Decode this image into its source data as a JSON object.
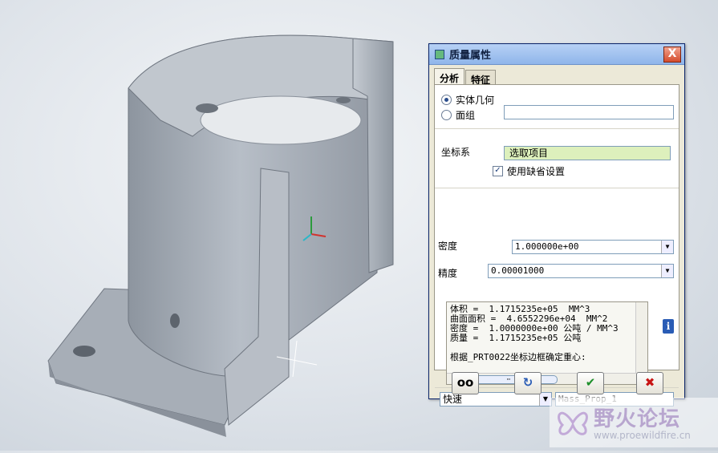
{
  "dialog": {
    "title": "质量属性",
    "close": "X",
    "tabs": [
      "分析",
      "特征"
    ],
    "geometry": {
      "solid": "实体几何",
      "quilt": "面组"
    },
    "csys_label": "坐标系",
    "csys_value": "选取项目",
    "use_default": "使用缺省设置",
    "density_label": "密度",
    "density_value": "1.000000e+00",
    "accuracy_label": "精度",
    "accuracy_value": "0.00001000",
    "results": [
      "体积 =  1.1715235e+05  MM^3",
      "曲面面积 =  4.6552296e+04  MM^2",
      "密度 =  1.0000000e+00 公吨 / MM^3",
      "质量 =  1.1715235e+05 公吨",
      "",
      "根据_PRT0022坐标边框确定重心:"
    ],
    "mode_value": "快速",
    "name_placeholder": "Mass_Prop_1",
    "scroll_thumb": "⋯",
    "buttons": {
      "preview": "oo",
      "repeat": "↻",
      "ok": "✔",
      "cancel": "✖"
    },
    "info": "i"
  },
  "watermark": {
    "title": "野火论坛",
    "url": "www.proewildfire.cn"
  },
  "colors": {
    "ok": "#1d8f2a",
    "cancel": "#c81414",
    "part": "#9aa2ad"
  }
}
